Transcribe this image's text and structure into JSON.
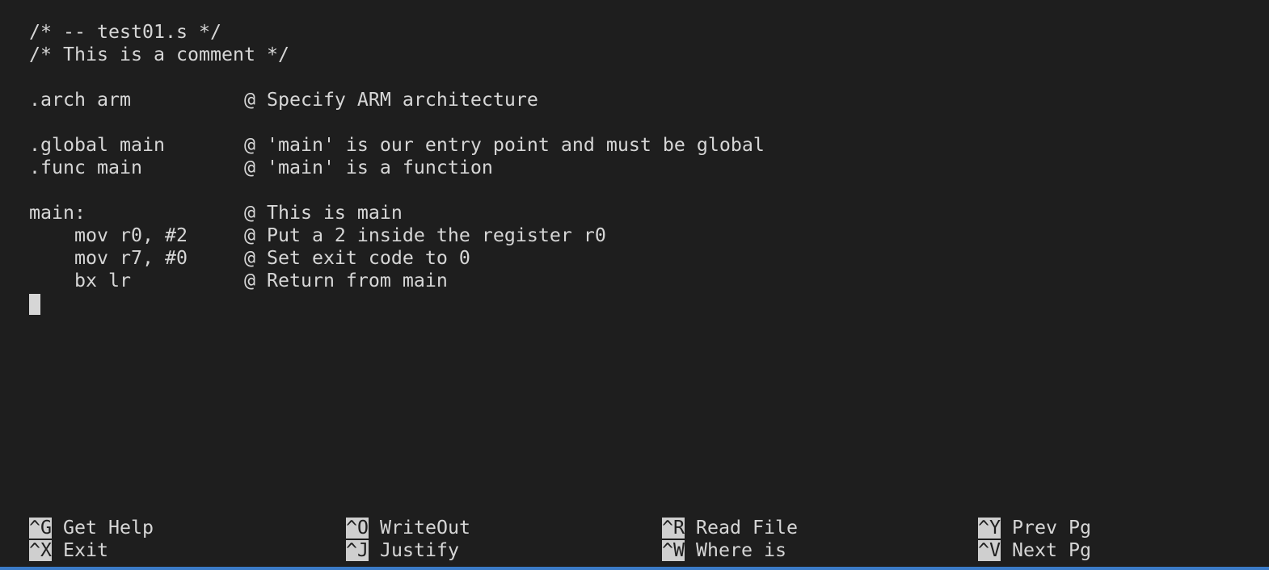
{
  "editor": {
    "lines": [
      "/* -- test01.s */",
      "/* This is a comment */",
      "",
      ".arch arm          @ Specify ARM architecture",
      "",
      ".global main       @ 'main' is our entry point and must be global",
      ".func main         @ 'main' is a function",
      "",
      "main:              @ This is main",
      "    mov r0, #2     @ Put a 2 inside the register r0",
      "    mov r7, #0     @ Set exit code to 0",
      "    bx lr          @ Return from main"
    ],
    "cursor_line": 13
  },
  "shortcuts": {
    "row1": [
      {
        "key": "^G",
        "label": "Get Help"
      },
      {
        "key": "^O",
        "label": "WriteOut"
      },
      {
        "key": "^R",
        "label": "Read File"
      },
      {
        "key": "^Y",
        "label": "Prev Pg"
      }
    ],
    "row2": [
      {
        "key": "^X",
        "label": "Exit"
      },
      {
        "key": "^J",
        "label": "Justify"
      },
      {
        "key": "^W",
        "label": "Where is"
      },
      {
        "key": "^V",
        "label": "Next Pg"
      }
    ]
  },
  "colors": {
    "background": "#1e1e1e",
    "text": "#d6d6d6",
    "key_bg": "#cfcfcf",
    "status_bar": "#3b7bc8"
  }
}
